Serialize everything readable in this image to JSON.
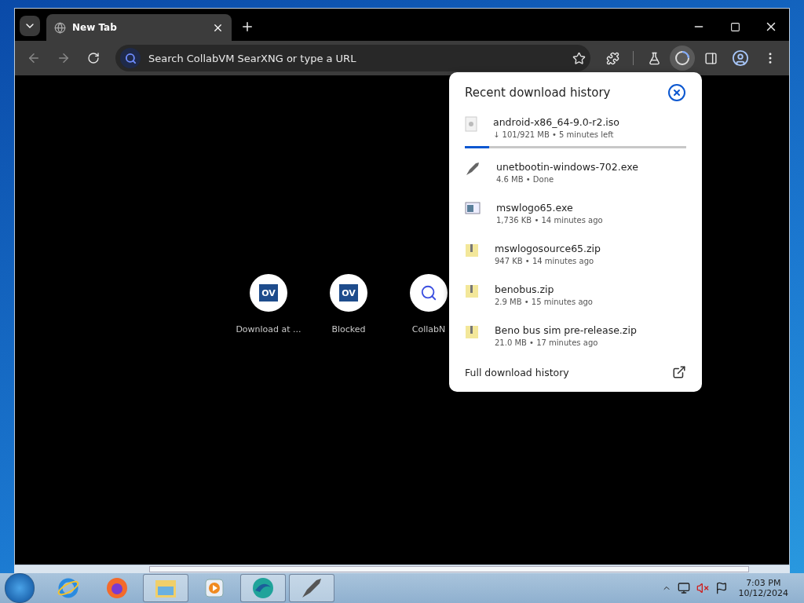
{
  "window": {
    "tab": {
      "title": "New Tab",
      "selected": true
    }
  },
  "toolbar": {
    "omnibox": {
      "placeholder": "Search CollabVM SearXNG or type a URL"
    }
  },
  "shortcuts": [
    {
      "label": "Download at ...",
      "logo": "OV",
      "kind": "ov"
    },
    {
      "label": "Blocked",
      "logo": "OV",
      "kind": "ov"
    },
    {
      "label": "CollabN",
      "kind": "search"
    }
  ],
  "downloads_panel": {
    "title": "Recent download history",
    "items": [
      {
        "name": "android-x86_64-9.0-r2.iso",
        "status": "↓ 101/921 MB • 5 minutes left",
        "kind": "iso",
        "level": 0.11
      },
      {
        "name": "unetbootin-windows-702.exe",
        "status": "4.6 MB • Done",
        "kind": "rocket"
      },
      {
        "name": "mswlogo65.exe",
        "status": "1,736 KB • 14 minutes ago",
        "kind": "exe"
      },
      {
        "name": "mswlogosource65.zip",
        "status": "947 KB • 14 minutes ago",
        "kind": "zip"
      },
      {
        "name": "benobus.zip",
        "status": "2.9 MB • 15 minutes ago",
        "kind": "zip"
      },
      {
        "name": "Beno bus sim pre-release.zip",
        "status": "21.0 MB • 17 minutes ago",
        "kind": "zip"
      }
    ],
    "footer": "Full download history"
  },
  "taskbar": {
    "apps": [
      {
        "kind": "ie",
        "selected": false
      },
      {
        "kind": "firefox",
        "selected": false
      },
      {
        "kind": "explorer",
        "selected": true
      },
      {
        "kind": "media",
        "selected": false
      },
      {
        "kind": "edge",
        "selected": true
      },
      {
        "kind": "rocket",
        "selected": true
      }
    ],
    "time": "7:03 PM",
    "date": "10/12/2024"
  }
}
